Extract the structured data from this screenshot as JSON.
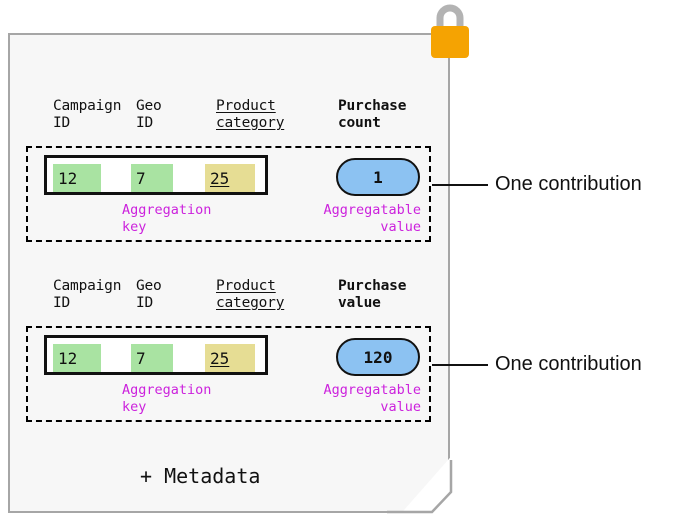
{
  "diagram": {
    "title_text": "",
    "colors": {
      "sheet_fill": "#f7f7f7",
      "sheet_border": "#a6a6a6",
      "lock_body": "#f5a302",
      "lock_shackle": "#b3b3b3",
      "key_highlight_green": "#a9e3a2",
      "key_highlight_yellow": "#e6dd94",
      "value_pill_fill": "#8cc2f2",
      "caption_magenta": "#cc22dd",
      "outline_black": "#111111"
    },
    "lock": {
      "icon": "padlock-icon",
      "state": "locked"
    },
    "footer": {
      "metadata_label": "+ Metadata"
    },
    "contributions": [
      {
        "headers": [
          {
            "text": "Campaign\nID",
            "style": "plain"
          },
          {
            "text": "Geo\nID",
            "style": "plain"
          },
          {
            "text": "Product\ncategory",
            "style": "underlined"
          },
          {
            "text": "Purchase\ncount",
            "style": "bold"
          }
        ],
        "key_cells": [
          {
            "value": "12",
            "highlight": "green",
            "underlined": false
          },
          {
            "value": "7",
            "highlight": "green",
            "underlined": false
          },
          {
            "value": "25",
            "highlight": "yellow",
            "underlined": true
          }
        ],
        "aggregation_key_caption": "Aggregation key",
        "aggregatable_value": "1",
        "aggregatable_value_caption": "Aggregatable\nvalue",
        "callout_label": "One contribution"
      },
      {
        "headers": [
          {
            "text": "Campaign\nID",
            "style": "plain"
          },
          {
            "text": "Geo\nID",
            "style": "plain"
          },
          {
            "text": "Product\ncategory",
            "style": "underlined"
          },
          {
            "text": "Purchase\nvalue",
            "style": "bold"
          }
        ],
        "key_cells": [
          {
            "value": "12",
            "highlight": "green",
            "underlined": false
          },
          {
            "value": "7",
            "highlight": "green",
            "underlined": false
          },
          {
            "value": "25",
            "highlight": "yellow",
            "underlined": true
          }
        ],
        "aggregation_key_caption": "Aggregation key",
        "aggregatable_value": "120",
        "aggregatable_value_caption": "Aggregatable\nvalue",
        "callout_label": "One contribution"
      }
    ]
  }
}
